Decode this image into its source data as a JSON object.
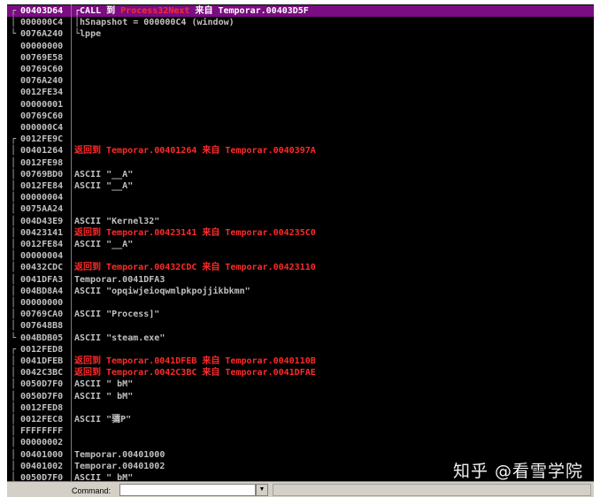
{
  "stack": [
    {
      "addr": "00403D64",
      "parts": [
        {
          "t": "CALL 到 ",
          "c": "n"
        },
        {
          "t": "Process32Next",
          "c": "p"
        },
        {
          "t": " 来自 Temporar.00403D5F",
          "c": "n"
        }
      ],
      "sel": true,
      "bracket": "top"
    },
    {
      "addr": "000000C4",
      "parts": [
        {
          "t": "hSnapshot = 000000C4 (window)",
          "c": "n"
        }
      ],
      "bracket": "mid"
    },
    {
      "addr": "0076A240",
      "parts": [
        {
          "t": "lppe",
          "c": "n"
        }
      ],
      "bracket": "end"
    },
    {
      "addr": "00000000",
      "parts": []
    },
    {
      "addr": "00769E58",
      "parts": []
    },
    {
      "addr": "00769C60",
      "parts": []
    },
    {
      "addr": "0076A240",
      "parts": []
    },
    {
      "addr": "0012FE34",
      "parts": []
    },
    {
      "addr": "00000001",
      "parts": []
    },
    {
      "addr": "00769C60",
      "parts": []
    },
    {
      "addr": "000000C4",
      "parts": []
    },
    {
      "addr": "0012FE9C",
      "parts": [],
      "bracket": "top"
    },
    {
      "addr": "00401264",
      "parts": [
        {
          "t": "返回到 Temporar.00401264 来自 Temporar.0040397A",
          "c": "r"
        }
      ]
    },
    {
      "addr": "0012FE98",
      "parts": []
    },
    {
      "addr": "00769BD0",
      "parts": [
        {
          "t": "ASCII \"__A\"",
          "c": "n"
        }
      ]
    },
    {
      "addr": "0012FE84",
      "parts": [
        {
          "t": "ASCII \"__A\"",
          "c": "n"
        }
      ]
    },
    {
      "addr": "00000004",
      "parts": []
    },
    {
      "addr": "0075AA24",
      "parts": []
    },
    {
      "addr": "004D43E9",
      "parts": [
        {
          "t": "ASCII \"Kernel32\"",
          "c": "n"
        }
      ]
    },
    {
      "addr": "00423141",
      "parts": [
        {
          "t": "返回到 Temporar.00423141 来自 Temporar.004235C0",
          "c": "r"
        }
      ]
    },
    {
      "addr": "0012FE84",
      "parts": [
        {
          "t": "ASCII \"__A\"",
          "c": "n"
        }
      ]
    },
    {
      "addr": "00000004",
      "parts": []
    },
    {
      "addr": "00432CDC",
      "parts": [
        {
          "t": "返回到 Temporar.00432CDC 来自 Temporar.00423110",
          "c": "r"
        }
      ]
    },
    {
      "addr": "0041DFA3",
      "parts": [
        {
          "t": "Temporar.0041DFA3",
          "c": "n"
        }
      ]
    },
    {
      "addr": "004BD8A4",
      "parts": [
        {
          "t": "ASCII \"opqiwjeioqwmlpkpojjikbkmn\"",
          "c": "n"
        }
      ]
    },
    {
      "addr": "00000000",
      "parts": []
    },
    {
      "addr": "00769CA0",
      "parts": [
        {
          "t": "ASCII \"Process]\"",
          "c": "n"
        }
      ]
    },
    {
      "addr": "007648B8",
      "parts": []
    },
    {
      "addr": "004BDB05",
      "parts": [
        {
          "t": "ASCII \"steam.exe\"",
          "c": "n"
        }
      ],
      "bracket": "end"
    },
    {
      "addr": "0012FED8",
      "parts": [],
      "bracket": "top"
    },
    {
      "addr": "0041DFEB",
      "parts": [
        {
          "t": "返回到 Temporar.0041DFEB 来自 Temporar.0040110B",
          "c": "r"
        }
      ]
    },
    {
      "addr": "0042C3BC",
      "parts": [
        {
          "t": "返回到 Temporar.0042C3BC 来自 Temporar.0041DFAE",
          "c": "r"
        }
      ]
    },
    {
      "addr": "0050D7F0",
      "parts": [
        {
          "t": "ASCII \" bM\"",
          "c": "n"
        }
      ]
    },
    {
      "addr": "0050D7F0",
      "parts": [
        {
          "t": "ASCII \" bM\"",
          "c": "n"
        }
      ]
    },
    {
      "addr": "0012FED8",
      "parts": []
    },
    {
      "addr": "0012FEC8",
      "parts": [
        {
          "t": "ASCII \"骦P\"",
          "c": "n"
        }
      ]
    },
    {
      "addr": "FFFFFFFF",
      "parts": []
    },
    {
      "addr": "00000002",
      "parts": []
    },
    {
      "addr": "00401000",
      "parts": [
        {
          "t": "Temporar.00401000",
          "c": "n"
        }
      ]
    },
    {
      "addr": "00401002",
      "parts": [
        {
          "t": "Temporar.00401002",
          "c": "n"
        }
      ]
    },
    {
      "addr": "0050D7F0",
      "parts": [
        {
          "t": "ASCII \" bM\"",
          "c": "n"
        }
      ]
    }
  ],
  "command_bar": {
    "label": "Command:",
    "value": ""
  },
  "watermark": "知乎 @看雪学院",
  "colors": {
    "background": "#000000",
    "text": "#c0c0c0",
    "return_text": "#ff2a2a",
    "selection": "#7b0d82"
  }
}
